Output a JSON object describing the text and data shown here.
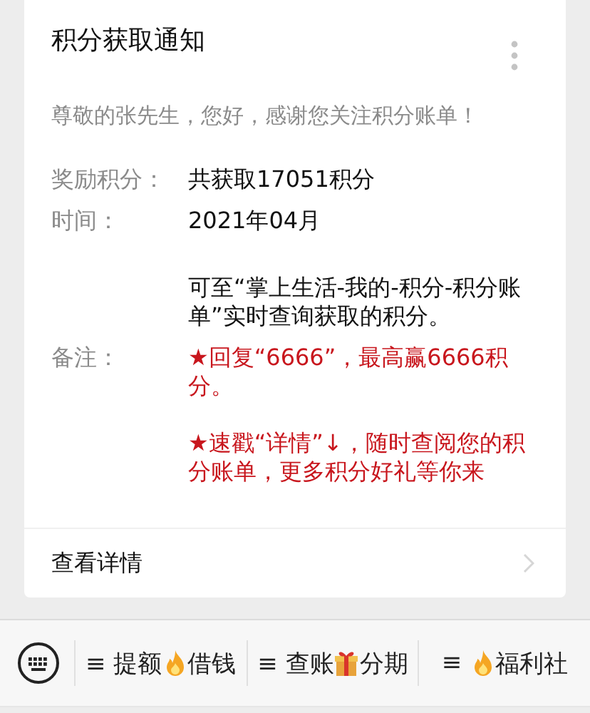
{
  "card": {
    "title": "积分获取通知",
    "greeting": "尊敬的张先生，您好，感谢您关注积分账单！",
    "rows": [
      {
        "label": "奖励积分：",
        "paragraphs": [
          {
            "text": "共获取17051积分",
            "kind": "normal"
          }
        ]
      },
      {
        "label": "时间：",
        "paragraphs": [
          {
            "text": "2021年04月",
            "kind": "normal"
          }
        ]
      },
      {
        "paragraphs": [
          {
            "text": "可至“掌上生活-我的-积分-积分账单”实时查询获取的积分。",
            "kind": "normal"
          }
        ]
      },
      {
        "label": "备注：",
        "paragraphs": [
          {
            "text": "★回复“6666”，最高赢6666积分。",
            "kind": "highlight"
          },
          {
            "text": "★速戳“详情”↓，随时查阅您的积分账单，更多积分好礼等你来",
            "kind": "highlight"
          }
        ]
      }
    ],
    "detail_link": "查看详情"
  },
  "menu_bar": {
    "items": [
      {
        "parts": [
          {
            "kind": "text",
            "text": "≡ 提额"
          },
          {
            "kind": "flame"
          },
          {
            "kind": "text",
            "text": "借钱"
          }
        ]
      },
      {
        "parts": [
          {
            "kind": "text",
            "text": "≡ 查账"
          },
          {
            "kind": "gift"
          },
          {
            "kind": "text",
            "text": "分期"
          }
        ]
      },
      {
        "parts": [
          {
            "kind": "text",
            "text": "≡ "
          },
          {
            "kind": "flame"
          },
          {
            "kind": "text",
            "text": "福利社"
          }
        ]
      }
    ]
  }
}
